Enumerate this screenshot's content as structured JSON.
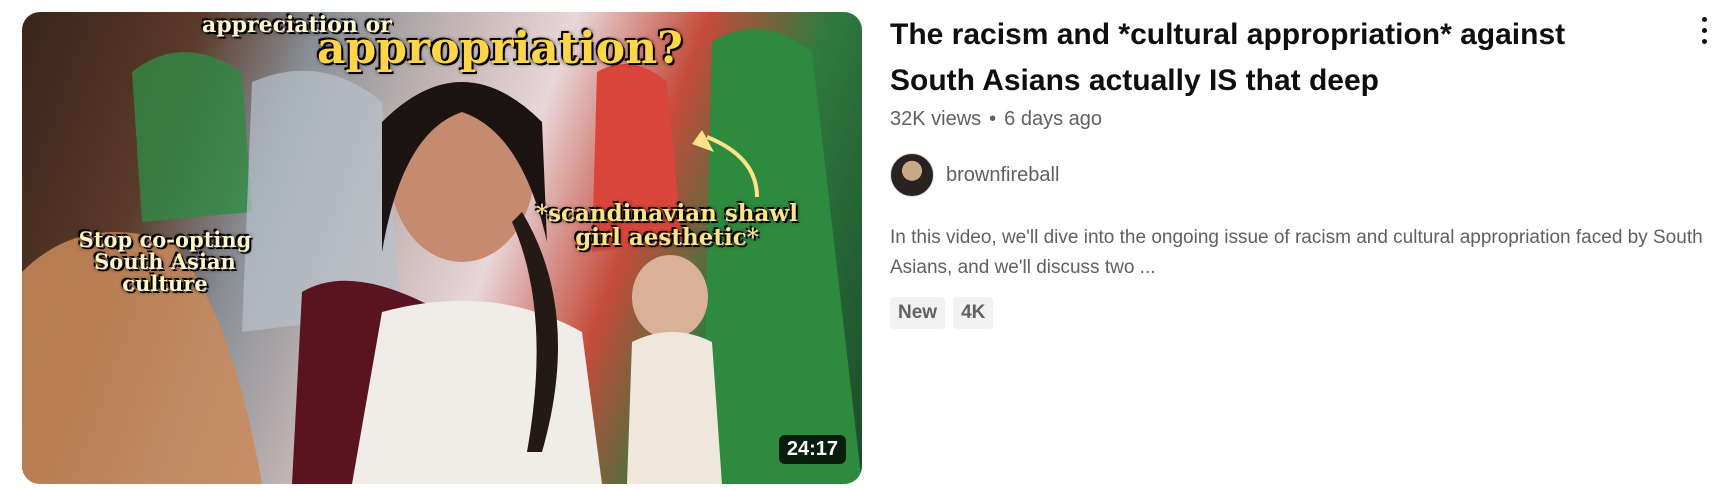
{
  "video": {
    "title": "The racism and *cultural appropriation* against South Asians actually IS that deep",
    "views": "32K views",
    "separator": "•",
    "age": "6 days ago",
    "duration": "24:17",
    "channel": "brownfireball",
    "description": "In this video, we'll dive into the ongoing issue of racism and cultural appropriation faced by South Asians, and we'll discuss two ...",
    "badges": [
      "New",
      "4K"
    ]
  },
  "thumbnail": {
    "caption_small": "appreciation or",
    "caption_big": "appropriation?",
    "caption_left": "Stop co-opting South Asian culture",
    "caption_right": "*scandinavian shawl girl aesthetic*"
  },
  "icons": {
    "menu": "more-vert-icon",
    "avatar": "channel-avatar"
  }
}
